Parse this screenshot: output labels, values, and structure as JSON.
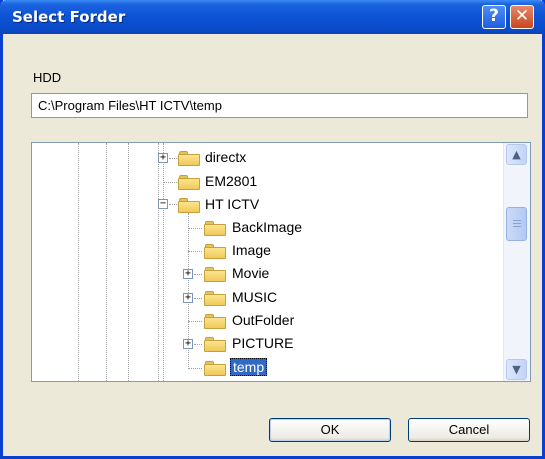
{
  "window": {
    "title": "Select Forder",
    "help_glyph": "?",
    "close_glyph": "✕"
  },
  "drive": {
    "label": "HDD",
    "path_value": "C:\\Program Files\\HT ICTV\\temp"
  },
  "tree": {
    "items": [
      {
        "label": "directx",
        "expander": "+"
      },
      {
        "label": "EM2801",
        "expander": ""
      },
      {
        "label": "HT ICTV",
        "expander": "−"
      },
      {
        "label": "BackImage",
        "expander": ""
      },
      {
        "label": "Image",
        "expander": ""
      },
      {
        "label": "Movie",
        "expander": "+"
      },
      {
        "label": "MUSIC",
        "expander": "+"
      },
      {
        "label": "OutFolder",
        "expander": ""
      },
      {
        "label": "PICTURE",
        "expander": "+"
      },
      {
        "label": "temp",
        "expander": "",
        "selected": true
      }
    ]
  },
  "scrollbar": {
    "up_glyph": "▲",
    "down_glyph": "▼"
  },
  "buttons": {
    "ok_label": "OK",
    "cancel_label": "Cancel"
  },
  "colors": {
    "titlebar": "#0c54d6",
    "selection": "#316ac5",
    "dialog_bg": "#ece9d8"
  }
}
